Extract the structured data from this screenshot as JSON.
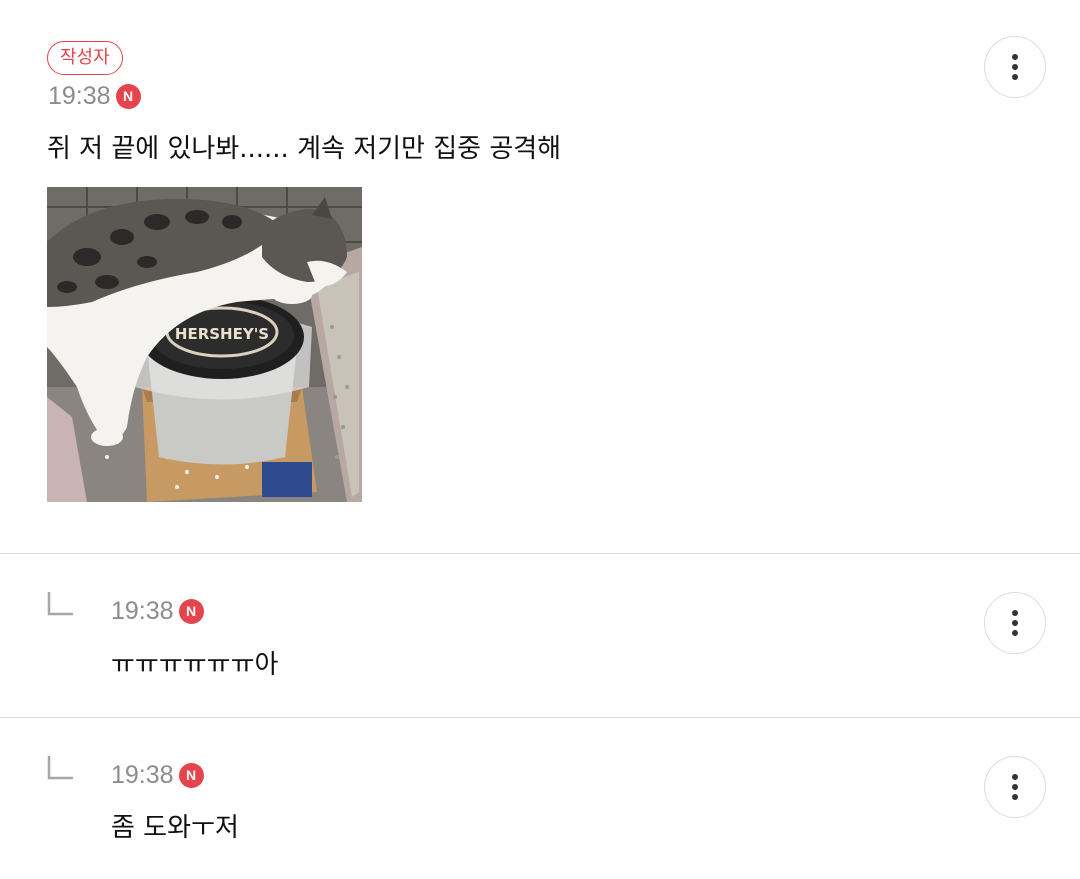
{
  "comments": [
    {
      "author_badge": "작성자",
      "time": "19:38",
      "new_badge": "N",
      "text": "쥐 저 끝에 있나봐...... 계속 저기만 집중 공격해",
      "photo": {
        "label_text": "HERSHEY'S"
      },
      "more_icon": "more-vertical-icon"
    },
    {
      "time": "19:38",
      "new_badge": "N",
      "text": "ㅠㅠㅠㅠㅠㅠ아",
      "reply_icon": "reply-arrow-icon",
      "more_icon": "more-vertical-icon"
    },
    {
      "time": "19:38",
      "new_badge": "N",
      "text": "좀 도와ㅜ저",
      "reply_icon": "reply-arrow-icon",
      "more_icon": "more-vertical-icon"
    }
  ],
  "colors": {
    "accent": "#e5444c",
    "meta_text": "#8c8c8c",
    "divider": "#dedede"
  }
}
